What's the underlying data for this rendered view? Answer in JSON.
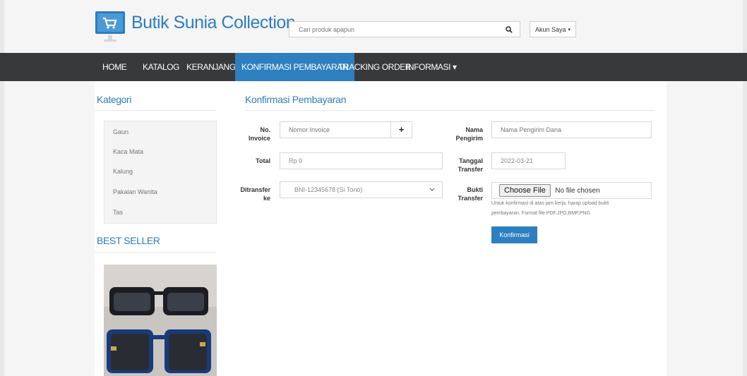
{
  "brand": {
    "name": "Butik Sunia Collection",
    "logo_icon": "shopping-cart-monitor-icon",
    "accent": "#2e7dc0"
  },
  "search": {
    "placeholder": "Cari produk apapun",
    "icon": "search-icon"
  },
  "account": {
    "label": "Akun Saya",
    "caret": "▾"
  },
  "nav": {
    "items": [
      {
        "label": "HOME"
      },
      {
        "label": "KATALOG"
      },
      {
        "label": "KERANJANG"
      },
      {
        "label": "KONFIRMASI PEMBAYARAN",
        "active": true
      },
      {
        "label": "TRACKING ORDER"
      },
      {
        "label": "INFORMASI ▾"
      }
    ],
    "background": "#37393b",
    "active_color": "#2e7fc0"
  },
  "sidebar": {
    "category_title": "Kategori",
    "categories": [
      "Gaun",
      "Kaca Mata",
      "Kalung",
      "Pakaian Wanita",
      "Tas"
    ],
    "bestseller_title": "BEST SELLER"
  },
  "form": {
    "title": "Konfirmasi Pembayaran",
    "invoice_label_1": "No.",
    "invoice_label_2": "Invoice",
    "invoice_placeholder": "Nomor Invoice",
    "invoice_addon": "+",
    "total_label": "Total",
    "total_value": "Rp 0",
    "transfer_to_label_1": "Ditransfer",
    "transfer_to_label_2": "ke",
    "transfer_to_value": "BNI-12345678 (Si Tono)",
    "sender_label_1": "Nama",
    "sender_label_2": "Pengirim",
    "sender_placeholder": "Nama Pengirim Dana",
    "date_label_1": "Tanggal",
    "date_label_2": "Transfer",
    "date_value": "2022-03-21",
    "proof_label_1": "Bukti",
    "proof_label_2": "Transfer",
    "choose_file": "Choose File",
    "no_file": "No file chosen",
    "help_1": "Untuk konfirmasi di atas jam kerja, harap upload bukti",
    "help_2": "pembayaran. Format file PDF,JPG,BMP,PNG",
    "submit": "Konfirmasi"
  }
}
